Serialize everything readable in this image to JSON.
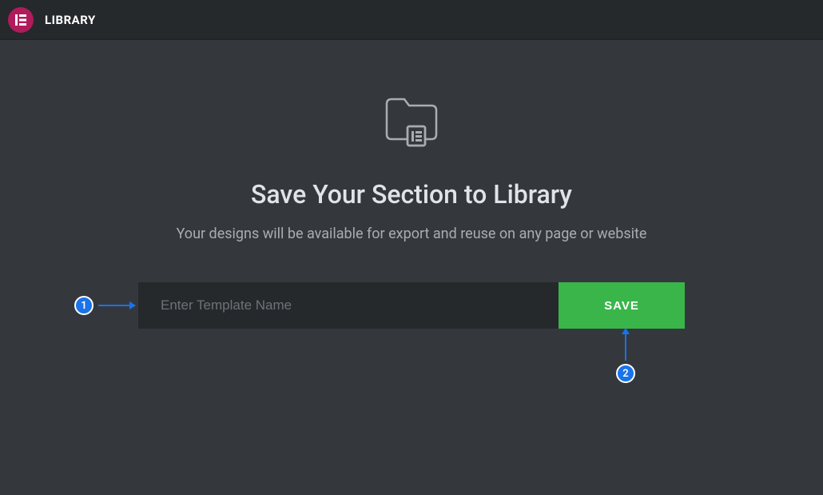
{
  "topbar": {
    "title": "LIBRARY",
    "logo_letter": "E"
  },
  "main": {
    "title": "Save Your Section to Library",
    "subtitle": "Your designs will be available for export and reuse on any page or website",
    "input_placeholder": "Enter Template Name",
    "input_value": "",
    "save_label": "SAVE"
  },
  "annotations": {
    "step1": "1",
    "step2": "2"
  }
}
